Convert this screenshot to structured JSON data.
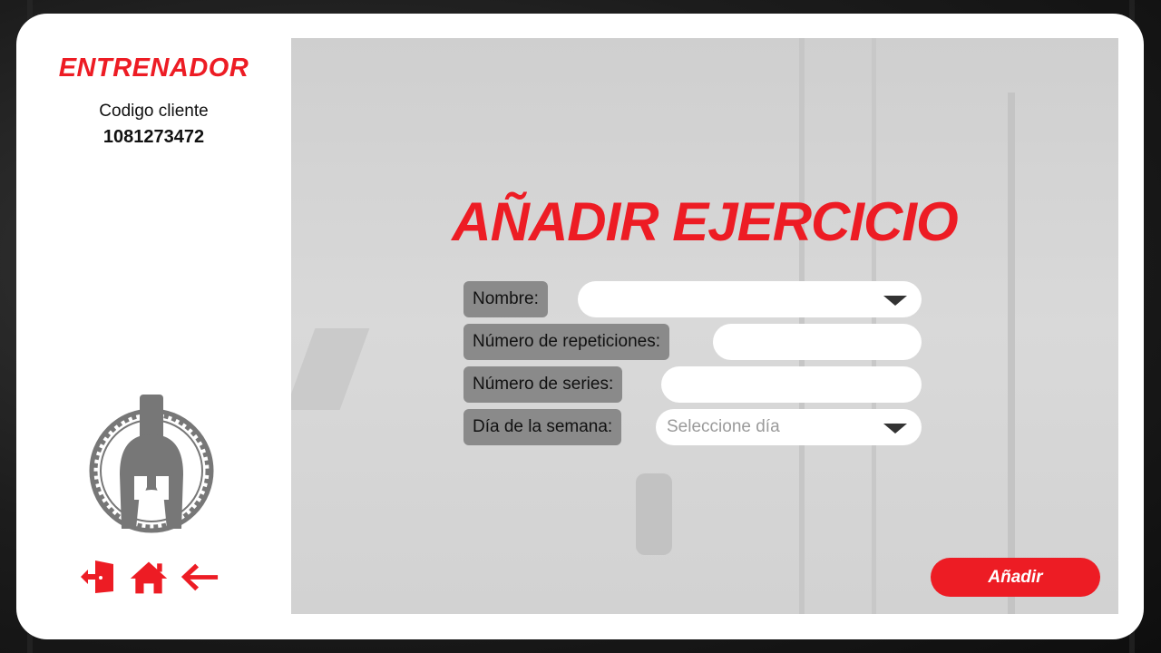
{
  "sidebar": {
    "brand": "ENTRENADOR",
    "client_label": "Codigo cliente",
    "client_code": "1081273472",
    "logo_icon": "spartan-helmet-icon",
    "nav": [
      {
        "icon": "exit-door-icon"
      },
      {
        "icon": "home-icon"
      },
      {
        "icon": "back-arrow-icon"
      }
    ]
  },
  "main": {
    "title": "AÑADIR EJERCICIO",
    "form": {
      "nombre_label": "Nombre:",
      "nombre_value": "",
      "repeticiones_label": "Número de repeticiones:",
      "repeticiones_value": "",
      "series_label": "Número de series:",
      "series_value": "",
      "dia_label": "Día de la semana:",
      "dia_placeholder": "Seleccione día"
    },
    "submit_label": "Añadir"
  },
  "colors": {
    "accent": "#ed1c24",
    "label_bg": "#8a8a8a",
    "panel_bg": "#d6d6d6"
  }
}
